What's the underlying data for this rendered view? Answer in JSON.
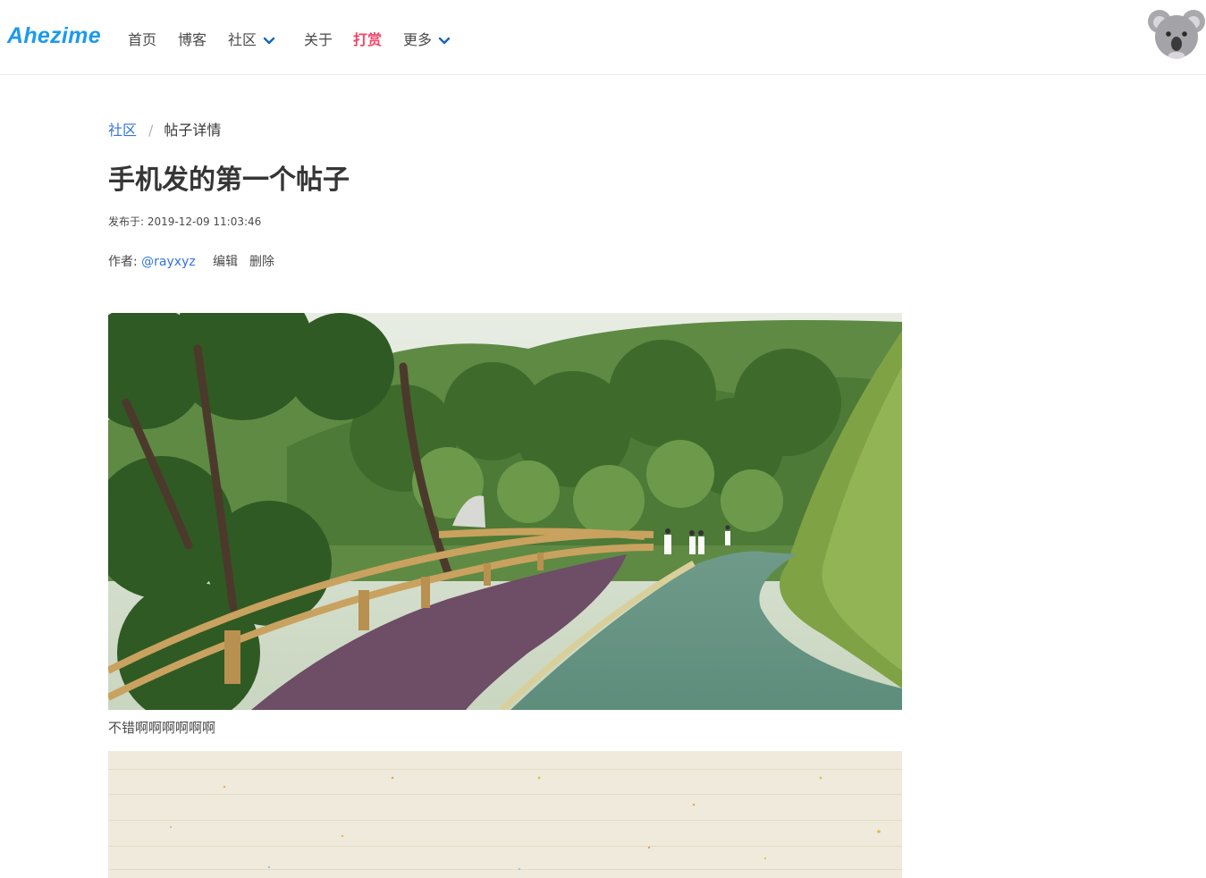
{
  "navbar": {
    "brand": "Ahezime",
    "items": [
      {
        "label": "首页"
      },
      {
        "label": "博客"
      },
      {
        "label": "社区"
      },
      {
        "label": "关于"
      },
      {
        "label": "打赏"
      },
      {
        "label": "更多"
      }
    ],
    "avatar_icon": "koala-icon"
  },
  "breadcrumb": {
    "parent": "社区",
    "separator": "/",
    "current": "帖子详情"
  },
  "post": {
    "title": "手机发的第一个帖子",
    "published": "发布于: 2019-12-09 11:03:46",
    "author_prefix": "作者: ",
    "author": "@rayxyz",
    "edit_label": "编辑",
    "delete_label": "删除",
    "caption": "不错啊啊啊啊啊啊"
  },
  "colors": {
    "brand": "#1b9af0",
    "link": "#3273dc",
    "highlight": "#f14668"
  }
}
